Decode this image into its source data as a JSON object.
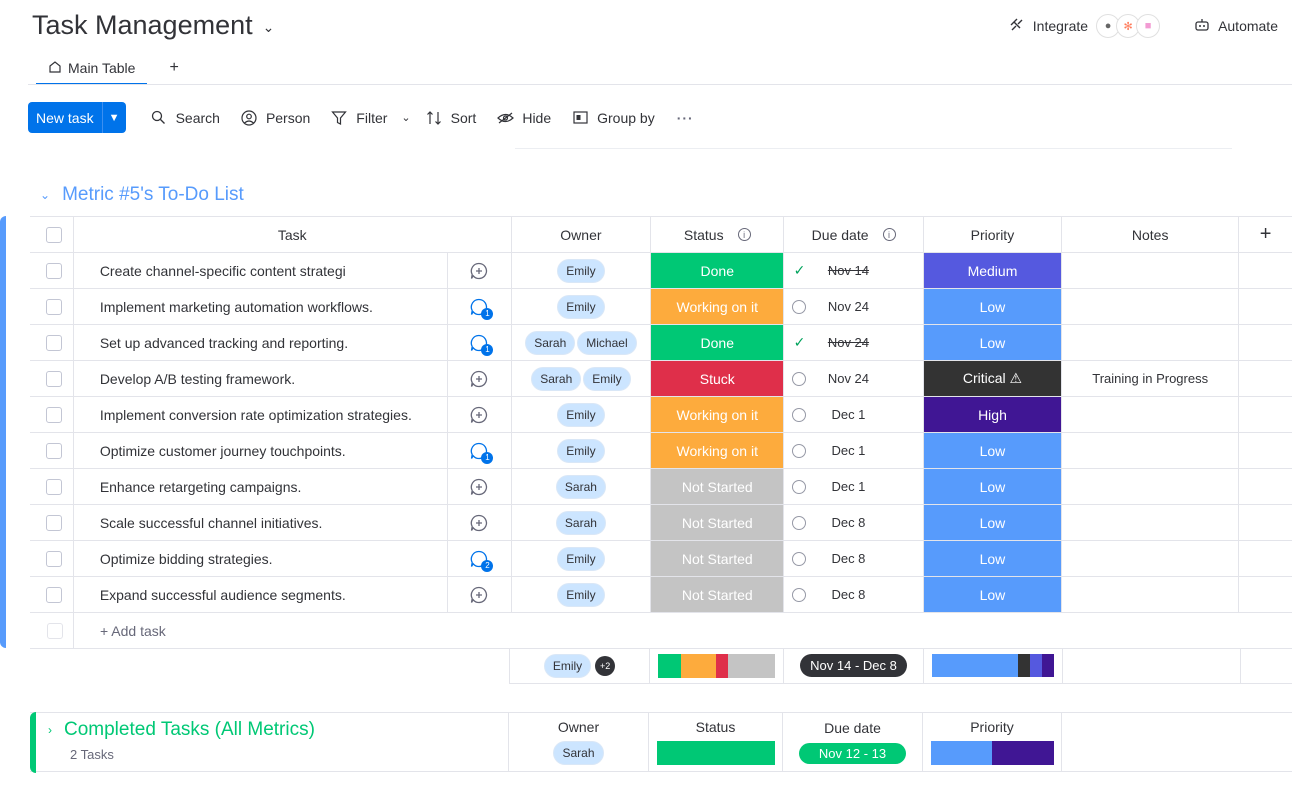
{
  "header": {
    "title": "Task Management",
    "integrate_label": "Integrate",
    "automate_label": "Automate"
  },
  "tabs": [
    {
      "label": "Main Table"
    }
  ],
  "toolbar": {
    "new_task": "New task",
    "search": "Search",
    "person": "Person",
    "filter": "Filter",
    "sort": "Sort",
    "hide": "Hide",
    "group_by": "Group by"
  },
  "group": {
    "title": "Metric #5's To-Do List",
    "columns": {
      "task": "Task",
      "owner": "Owner",
      "status": "Status",
      "due_date": "Due date",
      "priority": "Priority",
      "notes": "Notes"
    },
    "rows": [
      {
        "task": "Create channel-specific content strategi",
        "conv": "add",
        "owners": [
          "Emily"
        ],
        "status": "Done",
        "status_color": "#00c875",
        "due": "Nov 14",
        "due_done": true,
        "priority": "Medium",
        "priority_color": "#5559df",
        "notes": ""
      },
      {
        "task": "Implement marketing automation workflows.",
        "conv": "1",
        "owners": [
          "Emily"
        ],
        "status": "Working on it",
        "status_color": "#fdab3d",
        "due": "Nov 24",
        "due_done": false,
        "priority": "Low",
        "priority_color": "#579bfc",
        "notes": ""
      },
      {
        "task": "Set up advanced tracking and reporting.",
        "conv": "1",
        "owners": [
          "Sarah",
          "Michael"
        ],
        "status": "Done",
        "status_color": "#00c875",
        "due": "Nov 24",
        "due_done": true,
        "priority": "Low",
        "priority_color": "#579bfc",
        "notes": ""
      },
      {
        "task": "Develop A/B testing framework.",
        "conv": "add",
        "owners": [
          "Sarah",
          "Emily"
        ],
        "status": "Stuck",
        "status_color": "#df2f4a",
        "due": "Nov 24",
        "due_done": false,
        "priority": "Critical ⚠",
        "priority_color": "#333333",
        "notes": "Training in Progress"
      },
      {
        "task": "Implement conversion rate optimization strategies.",
        "conv": "add",
        "owners": [
          "Emily"
        ],
        "status": "Working on it",
        "status_color": "#fdab3d",
        "due": "Dec 1",
        "due_done": false,
        "priority": "High",
        "priority_color": "#401694",
        "notes": ""
      },
      {
        "task": "Optimize customer journey touchpoints.",
        "conv": "1",
        "owners": [
          "Emily"
        ],
        "status": "Working on it",
        "status_color": "#fdab3d",
        "due": "Dec 1",
        "due_done": false,
        "priority": "Low",
        "priority_color": "#579bfc",
        "notes": ""
      },
      {
        "task": "Enhance retargeting campaigns.",
        "conv": "add",
        "owners": [
          "Sarah"
        ],
        "status": "Not Started",
        "status_color": "#c4c4c4",
        "due": "Dec 1",
        "due_done": false,
        "priority": "Low",
        "priority_color": "#579bfc",
        "notes": ""
      },
      {
        "task": "Scale successful channel initiatives.",
        "conv": "add",
        "owners": [
          "Sarah"
        ],
        "status": "Not Started",
        "status_color": "#c4c4c4",
        "due": "Dec 8",
        "due_done": false,
        "priority": "Low",
        "priority_color": "#579bfc",
        "notes": ""
      },
      {
        "task": "Optimize bidding strategies.",
        "conv": "2",
        "owners": [
          "Emily"
        ],
        "status": "Not Started",
        "status_color": "#c4c4c4",
        "due": "Dec 8",
        "due_done": false,
        "priority": "Low",
        "priority_color": "#579bfc",
        "notes": ""
      },
      {
        "task": "Expand successful audience segments.",
        "conv": "add",
        "owners": [
          "Emily"
        ],
        "status": "Not Started",
        "status_color": "#c4c4c4",
        "due": "Dec 8",
        "due_done": false,
        "priority": "Low",
        "priority_color": "#579bfc",
        "notes": ""
      }
    ],
    "add_task": "+ Add task",
    "summary": {
      "owner": "Emily",
      "owner_more": "+2",
      "status_bar": [
        {
          "color": "#00c875",
          "fraction": 0.2
        },
        {
          "color": "#fdab3d",
          "fraction": 0.3
        },
        {
          "color": "#df2f4a",
          "fraction": 0.1
        },
        {
          "color": "#c4c4c4",
          "fraction": 0.4
        }
      ],
      "due_range": "Nov 14 - Dec 8",
      "priority_bar": [
        {
          "color": "#579bfc",
          "fraction": 0.7
        },
        {
          "color": "#333333",
          "fraction": 0.1
        },
        {
          "color": "#5559df",
          "fraction": 0.1
        },
        {
          "color": "#401694",
          "fraction": 0.1
        }
      ]
    }
  },
  "completed_group": {
    "title": "Completed Tasks (All Metrics)",
    "count": "2 Tasks",
    "owner_header": "Owner",
    "status_header": "Status",
    "due_header": "Due date",
    "priority_header": "Priority",
    "owner": "Sarah",
    "due_range": "Nov 12 - 13",
    "status_bar": [
      {
        "color": "#00c875",
        "fraction": 1.0
      }
    ],
    "priority_bar": [
      {
        "color": "#579bfc",
        "fraction": 0.5
      },
      {
        "color": "#401694",
        "fraction": 0.5
      }
    ]
  }
}
